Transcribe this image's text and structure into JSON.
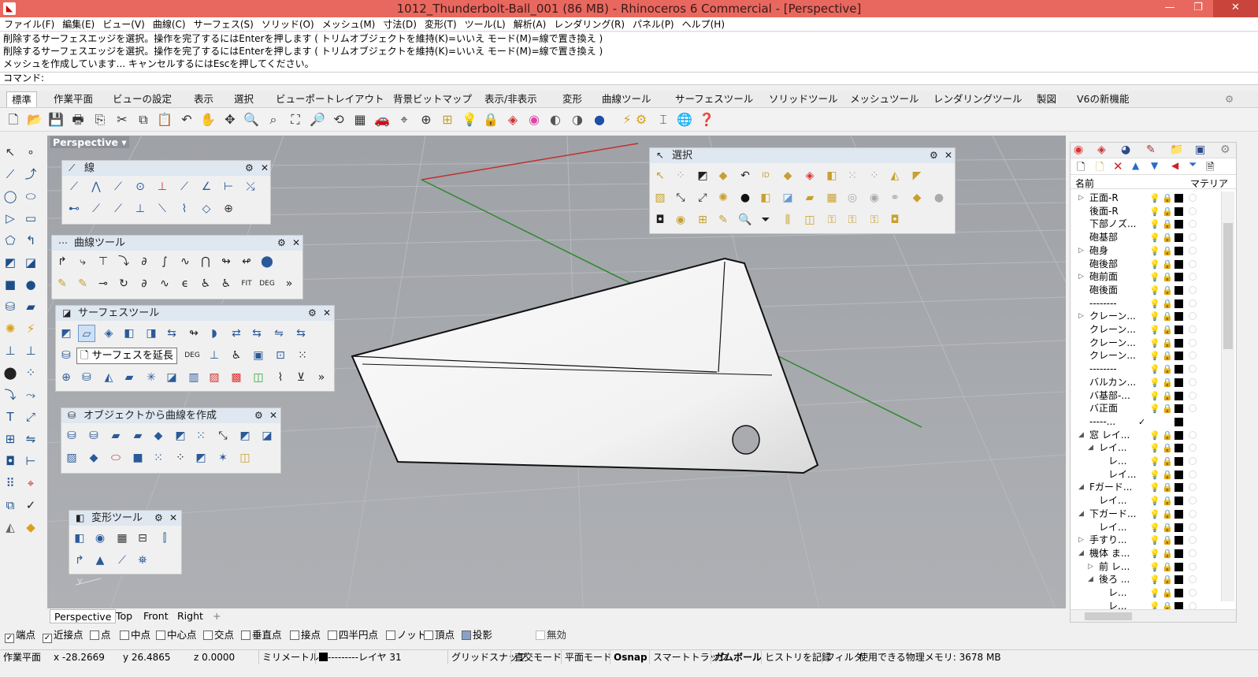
{
  "window": {
    "title": "1012_Thunderbolt-Ball_001 (86 MB) - Rhinoceros 6 Commercial - [Perspective]",
    "min": "—",
    "max": "❐",
    "close": "✕"
  },
  "menu": [
    "ファイル(F)",
    "編集(E)",
    "ビュー(V)",
    "曲線(C)",
    "サーフェス(S)",
    "ソリッド(O)",
    "メッシュ(M)",
    "寸法(D)",
    "変形(T)",
    "ツール(L)",
    "解析(A)",
    "レンダリング(R)",
    "パネル(P)",
    "ヘルプ(H)"
  ],
  "history": [
    "削除するサーフェスエッジを選択。操作を完了するにはEnterを押します ( トリムオブジェクトを維持(K)=いいえ  モード(M)=線で置き換え )",
    "削除するサーフェスエッジを選択。操作を完了するにはEnterを押します ( トリムオブジェクトを維持(K)=いいえ  モード(M)=線で置き換え )",
    "メッシュを作成しています... キャンセルするにはEscを押してください。"
  ],
  "command_label": "コマンド:",
  "tabs": [
    "標準",
    "作業平面",
    "ビューの設定",
    "表示",
    "選択",
    "ビューポートレイアウト",
    "背景ビットマップ",
    "表示/非表示",
    "変形",
    "曲線ツール",
    "サーフェスツール",
    "ソリッドツール",
    "メッシュツール",
    "レンダリングツール",
    "製図",
    "V6の新機能"
  ],
  "viewport_label": "Perspective",
  "viewport_label_arrow": "▾",
  "panels": {
    "line": "線",
    "curve_tools": "曲線ツール",
    "surface_tools": "サーフェスツール",
    "curve_from_objects": "オブジェクトから曲線を作成",
    "transform": "変形ツール",
    "select": "選択"
  },
  "tooltip": "サーフェスを延長",
  "view_tabs": [
    "Perspective",
    "Top",
    "Front",
    "Right"
  ],
  "view_add": "+",
  "osnap": [
    {
      "label": "端点",
      "checked": true
    },
    {
      "label": "近接点",
      "checked": true
    },
    {
      "label": "点",
      "checked": false
    },
    {
      "label": "中点",
      "checked": false
    },
    {
      "label": "中心点",
      "checked": false
    },
    {
      "label": "交点",
      "checked": false
    },
    {
      "label": "垂直点",
      "checked": false
    },
    {
      "label": "接点",
      "checked": false
    },
    {
      "label": "四半円点",
      "checked": false
    },
    {
      "label": "ノット",
      "checked": false
    },
    {
      "label": "頂点",
      "checked": false
    },
    {
      "label": "投影",
      "checked": false
    },
    {
      "label": "無効",
      "checked": false
    }
  ],
  "status": {
    "cplane": "作業平面",
    "x": "x -28.2669",
    "y": "y 26.4865",
    "z": "z 0.0000",
    "units": "ミリメートル",
    "layer": "---------レイヤ 31",
    "grid_snap": "グリッドスナップ",
    "ortho": "直交モード",
    "planar": "平面モード",
    "osnap": "Osnap",
    "smarttrack": "スマートトラック",
    "gumball": "ガムボール",
    "history": "ヒストリを記録",
    "filter": "フィルタ",
    "memory": "使用できる物理メモリ: 3678 MB"
  },
  "layers_header": {
    "name": "名前",
    "material": "マテリア"
  },
  "layers": [
    {
      "name": "正面-R",
      "expand": "▷"
    },
    {
      "name": "後面-R",
      "expand": ""
    },
    {
      "name": "下部ノズ...",
      "expand": ""
    },
    {
      "name": "砲基部",
      "expand": ""
    },
    {
      "name": "砲身",
      "expand": "▷"
    },
    {
      "name": "砲後部",
      "expand": ""
    },
    {
      "name": "砲前面",
      "expand": "▷"
    },
    {
      "name": "砲後面",
      "expand": ""
    },
    {
      "name": "--------",
      "expand": ""
    },
    {
      "name": "クレーン...",
      "expand": "▷"
    },
    {
      "name": "クレーン...",
      "expand": ""
    },
    {
      "name": "クレーン...",
      "expand": ""
    },
    {
      "name": "クレーン...",
      "expand": ""
    },
    {
      "name": "--------",
      "expand": ""
    },
    {
      "name": "バルカン...",
      "expand": ""
    },
    {
      "name": "バ基部-...",
      "expand": ""
    },
    {
      "name": "バ正面",
      "expand": ""
    },
    {
      "name": "-----...",
      "expand": ""
    },
    {
      "name": "窓  レイ...",
      "expand": "◢"
    },
    {
      "name": "レイ...",
      "expand": "◢"
    },
    {
      "name": "レ...",
      "expand": ""
    },
    {
      "name": "レイ...",
      "expand": ""
    },
    {
      "name": "Fガード...",
      "expand": "◢"
    },
    {
      "name": "レイ...",
      "expand": ""
    },
    {
      "name": "下ガード...",
      "expand": "◢"
    },
    {
      "name": "レイ...",
      "expand": ""
    },
    {
      "name": "手すり...",
      "expand": "▷"
    },
    {
      "name": "機体 ま...",
      "expand": "◢"
    },
    {
      "name": "前 レ...",
      "expand": "▷"
    },
    {
      "name": "後ろ ...",
      "expand": "◢"
    },
    {
      "name": "レ...",
      "expand": ""
    },
    {
      "name": "レ...",
      "expand": ""
    }
  ],
  "axis_label": "y"
}
